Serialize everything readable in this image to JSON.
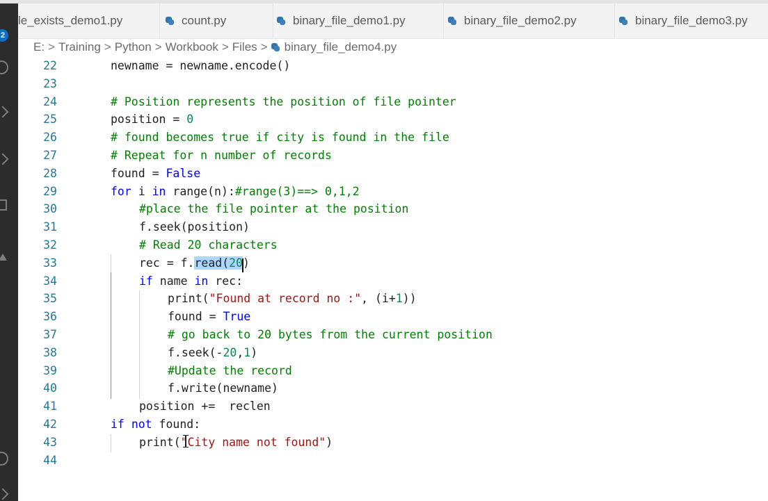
{
  "tabs": [
    {
      "label": "le_exists_demo1.py",
      "icon": "python-file-icon"
    },
    {
      "label": "count.py",
      "icon": "python-file-icon"
    },
    {
      "label": "binary_file_demo1.py",
      "icon": "python-file-icon"
    },
    {
      "label": "binary_file_demo2.py",
      "icon": "python-file-icon"
    },
    {
      "label": "binary_file_demo3.py",
      "icon": "python-file-icon"
    }
  ],
  "activity_bar": {
    "badge_count": "2"
  },
  "breadcrumb": {
    "items": [
      "E:",
      "Training",
      "Python",
      "Workbook",
      "Files",
      "binary_file_demo4.py"
    ],
    "separator": ">"
  },
  "colors": {
    "keyword": "#0000ff",
    "comment": "#008000",
    "string": "#a31515",
    "number": "#098658",
    "line_number": "#237893",
    "selection": "#add6ff"
  },
  "code_lines": [
    {
      "num": "22",
      "text": "newname = newname.encode()"
    },
    {
      "num": "23",
      "text": ""
    },
    {
      "num": "24",
      "text": "# Position represents the position of file pointer"
    },
    {
      "num": "25",
      "text": "position = 0"
    },
    {
      "num": "26",
      "text": "# found becomes true if city is found in the file"
    },
    {
      "num": "27",
      "text": "# Repeat for n number of records"
    },
    {
      "num": "28",
      "text": "found = False"
    },
    {
      "num": "29",
      "text": "for i in range(n):#range(3)==> 0,1,2"
    },
    {
      "num": "30",
      "text": "#place the file pointer at the position"
    },
    {
      "num": "31",
      "text": "f.seek(position)"
    },
    {
      "num": "32",
      "text": "# Read 20 characters"
    },
    {
      "num": "33",
      "text": "rec = f.read(20)"
    },
    {
      "num": "34",
      "text": "if name in rec:"
    },
    {
      "num": "35",
      "text": "print(\"Found at record no :\", (i+1))"
    },
    {
      "num": "36",
      "text": "found = True"
    },
    {
      "num": "37",
      "text": "# go back to 20 bytes from the current position"
    },
    {
      "num": "38",
      "text": "f.seek(-20,1)"
    },
    {
      "num": "39",
      "text": "#Update the record"
    },
    {
      "num": "40",
      "text": "f.write(newname)"
    },
    {
      "num": "41",
      "text": "position +=  reclen"
    },
    {
      "num": "42",
      "text": "if not found:"
    },
    {
      "num": "43",
      "text": "print(\"City name not found\")"
    },
    {
      "num": "44",
      "text": ""
    }
  ]
}
